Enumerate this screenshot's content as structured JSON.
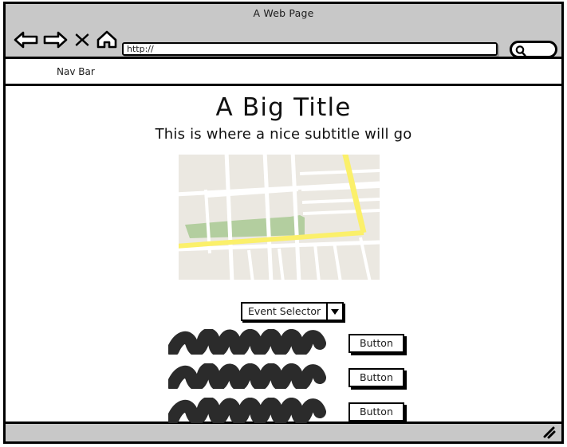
{
  "window": {
    "title": "A Web Page"
  },
  "toolbar": {
    "back_icon": "back-arrow-icon",
    "forward_icon": "forward-arrow-icon",
    "stop_icon": "close-x-icon",
    "home_icon": "home-icon",
    "url_value": "http://",
    "url_placeholder": "http://",
    "search_icon": "search-icon",
    "search_value": ""
  },
  "nav": {
    "label": "Nav Bar"
  },
  "main": {
    "title": "A Big Title",
    "subtitle": "This is where a nice subtitle will go"
  },
  "map": {
    "name": "map-widget",
    "background_color": "#ebe8e1",
    "street_color": "#ffffff",
    "highway_color": "#fbf06a",
    "park_color": "#b3ce9f"
  },
  "event_selector": {
    "value": "Event Selector",
    "arrow_icon": "chevron-down-icon"
  },
  "rows": [
    {
      "scribble": "scribble-placeholder",
      "button_label": "Button"
    },
    {
      "scribble": "scribble-placeholder",
      "button_label": "Button"
    },
    {
      "scribble": "scribble-placeholder",
      "button_label": "Button"
    }
  ],
  "footer": {
    "resize_icon": "resize-grip-icon"
  },
  "colors": {
    "chrome": "#c8c8c8",
    "ink": "#000000",
    "scribble": "#2b2b2b",
    "page": "#ffffff"
  }
}
